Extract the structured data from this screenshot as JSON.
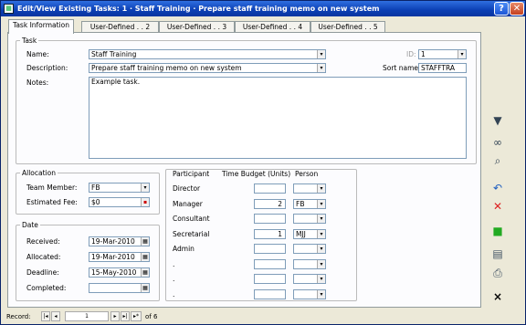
{
  "title": "Edit/View Existing Tasks:  1  · Staff Training  · Prepare staff training memo on new system",
  "tabs": [
    "Task Information",
    "User-Defined . . 2",
    "User-Defined . . 3",
    "User-Defined . . 4",
    "User-Defined . . 5"
  ],
  "task": {
    "legend": "Task",
    "name_label": "Name:",
    "name_value": "Staff Training",
    "desc_label": "Description:",
    "desc_value": "Prepare staff training memo on new system",
    "notes_label": "Notes:",
    "notes_value": "Example task.",
    "id_label": "ID:",
    "id_value": "1",
    "sort_label": "Sort name:",
    "sort_value": "STAFFTRA"
  },
  "allocation": {
    "legend": "Allocation",
    "team_label": "Team Member:",
    "team_value": "FB",
    "fee_label": "Estimated Fee:",
    "fee_value": "$0"
  },
  "date": {
    "legend": "Date",
    "received_label": "Received:",
    "received_value": "19-Mar-2010",
    "allocated_label": "Allocated:",
    "allocated_value": "19-Mar-2010",
    "deadline_label": "Deadline:",
    "deadline_value": "15-May-2010",
    "completed_label": "Completed:",
    "completed_value": ""
  },
  "participants": {
    "h_participant": "Participant",
    "h_budget": "Time Budget (Units)",
    "h_person": "Person",
    "rows": [
      {
        "name": "Director",
        "units": "",
        "person": ""
      },
      {
        "name": "Manager",
        "units": "2",
        "person": "FB"
      },
      {
        "name": "Consultant",
        "units": "",
        "person": ""
      },
      {
        "name": "Secretarial",
        "units": "1",
        "person": "MJJ"
      },
      {
        "name": "Admin",
        "units": "",
        "person": ""
      },
      {
        "name": ".",
        "units": "",
        "person": ""
      },
      {
        "name": ".",
        "units": "",
        "person": ""
      },
      {
        "name": ".",
        "units": "",
        "person": ""
      }
    ]
  },
  "record": {
    "label": "Record:",
    "current": "1",
    "of_label": "of 6"
  },
  "icons": {
    "filter": "filter-icon",
    "find": "binoculars-icon",
    "zoom": "magnifier-icon",
    "undo": "undo-icon",
    "delete": "delete-icon",
    "save": "save-icon",
    "preview": "print-preview-icon",
    "print": "printer-icon",
    "close": "close-icon"
  },
  "colors": {
    "title_bar": "#0b3fb4",
    "delete": "#d22",
    "save": "#2a2",
    "undo": "#1f5fc0"
  }
}
